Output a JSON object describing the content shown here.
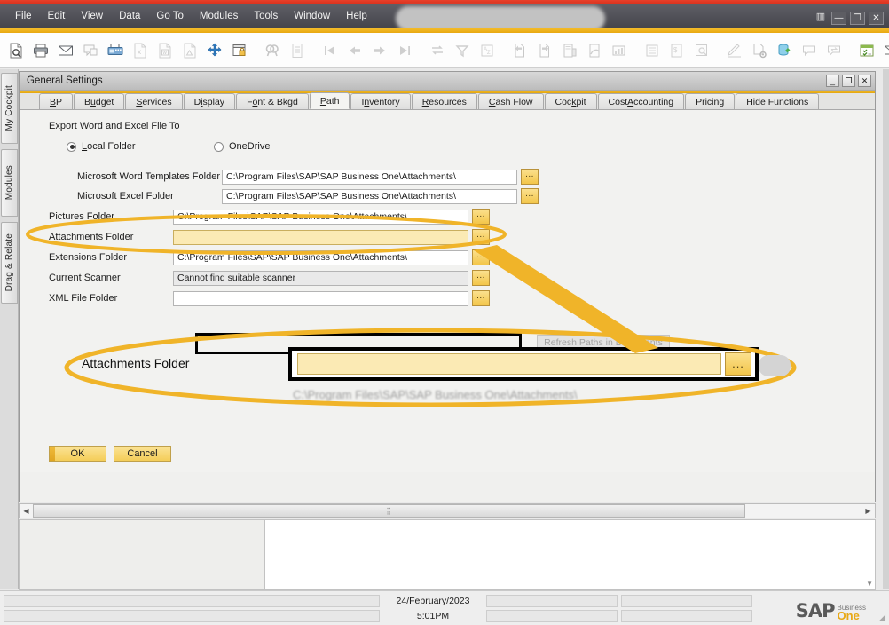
{
  "app": {
    "window_title_redacted": "",
    "window_controls": [
      "grid-icon",
      "minimize",
      "restore",
      "close"
    ]
  },
  "menubar": {
    "items": [
      {
        "label": "File",
        "accel": "F"
      },
      {
        "label": "Edit",
        "accel": "E"
      },
      {
        "label": "View",
        "accel": "V"
      },
      {
        "label": "Data",
        "accel": "D"
      },
      {
        "label": "Go To",
        "accel": "G"
      },
      {
        "label": "Modules",
        "accel": "M"
      },
      {
        "label": "Tools",
        "accel": "T"
      },
      {
        "label": "Window",
        "accel": "W"
      },
      {
        "label": "Help",
        "accel": "H"
      }
    ]
  },
  "toolbar": {
    "icons": [
      "print-preview-icon",
      "print-icon",
      "email-icon",
      "sms-icon",
      "fax-icon",
      "export-to-excel-icon",
      "export-to-word-icon",
      "export-to-pdf-icon",
      "launch-application-icon",
      "lock-screen-icon",
      "find-icon",
      "add-record-icon",
      "first-record-icon",
      "previous-record-icon",
      "next-record-icon",
      "last-record-icon",
      "refresh-icon",
      "filter-icon",
      "sort-icon",
      "copy-from-icon",
      "copy-to-icon",
      "document-data-icon",
      "cancel-document-icon",
      "report-icon",
      "gross-profit-icon",
      "document-journal-icon",
      "transaction-journal-icon",
      "approval-icon",
      "document-settings-icon",
      "data-source-icon",
      "message-icon",
      "send-message-icon",
      "calendar-icon",
      "messages-alerts-icon",
      "my-menu-icon"
    ]
  },
  "rail": {
    "tabs": [
      {
        "label": "My Cockpit"
      },
      {
        "label": "Modules"
      },
      {
        "label": "Drag & Relate"
      }
    ]
  },
  "form": {
    "title": "General Settings",
    "window_controls": [
      "minimize",
      "restore",
      "close"
    ],
    "tabs": [
      {
        "label": "BP",
        "accel": "B",
        "active": false
      },
      {
        "label": "Budget",
        "accel": "u",
        "active": false
      },
      {
        "label": "Services",
        "accel": "S",
        "active": false
      },
      {
        "label": "Display",
        "accel": "i",
        "active": false
      },
      {
        "label": "Font & Bkgd",
        "accel": "o",
        "active": false
      },
      {
        "label": "Path",
        "accel": "P",
        "active": true
      },
      {
        "label": "Inventory",
        "accel": "n",
        "active": false
      },
      {
        "label": "Resources",
        "accel": "R",
        "active": false
      },
      {
        "label": "Cash Flow",
        "accel": "C",
        "active": false
      },
      {
        "label": "Cockpit",
        "accel": "k",
        "active": false
      },
      {
        "label": "Cost Accounting",
        "accel": "A",
        "active": false
      },
      {
        "label": "Pricing",
        "accel": "",
        "active": false
      },
      {
        "label": "Hide Functions",
        "accel": "",
        "active": false
      }
    ],
    "section_label": "Export Word and Excel File To",
    "radio_options": [
      {
        "label": "Local Folder",
        "accel": "L",
        "checked": true
      },
      {
        "label": "OneDrive",
        "accel": "",
        "checked": false
      }
    ],
    "fields": [
      {
        "label": "Microsoft Word Templates Folder",
        "value": "C:\\Program Files\\SAP\\SAP Business One\\Attachments\\",
        "state": "normal",
        "indent": "deep"
      },
      {
        "label": "Microsoft Excel Folder",
        "value": "C:\\Program Files\\SAP\\SAP Business One\\Attachments\\",
        "state": "normal",
        "indent": "deep"
      },
      {
        "label": "Pictures Folder",
        "value": "C:\\Program Files\\SAP\\SAP Business One\\Attachments\\",
        "state": "normal",
        "indent": "shallow"
      },
      {
        "label": "Attachments Folder",
        "value": "",
        "state": "focused",
        "indent": "shallow"
      },
      {
        "label": "Extensions Folder",
        "value": "C:\\Program Files\\SAP\\SAP Business One\\Attachments\\",
        "state": "normal",
        "indent": "shallow"
      },
      {
        "label": "Current Scanner",
        "value": "Cannot find suitable scanner",
        "state": "readonly",
        "indent": "shallow"
      },
      {
        "label": "XML File Folder",
        "value": "",
        "state": "normal",
        "indent": "shallow"
      }
    ],
    "browse_button_label": "...",
    "refresh_button_label": "Refresh Paths in Documents",
    "buttons": [
      {
        "label": "OK",
        "default": true
      },
      {
        "label": "Cancel",
        "default": false
      }
    ]
  },
  "callout": {
    "label": "Attachments Folder",
    "field_value": "",
    "browse_label": "...",
    "ghost_text": "C:\\Program Files\\SAP\\SAP Business One\\Attachments\\",
    "highlight_color": "#f0b429"
  },
  "statusbar": {
    "date": "24/February/2023",
    "time": "5:01PM",
    "brand_primary": "SAP",
    "brand_secondary_top": "Business",
    "brand_secondary_bottom": "One"
  },
  "colors": {
    "accent_gold": "#eeab1a",
    "annotation": "#f0b429",
    "menu_bg": "#4f4f55",
    "red_strip": "#e0381f",
    "highlight_field": "#fbeab4"
  }
}
